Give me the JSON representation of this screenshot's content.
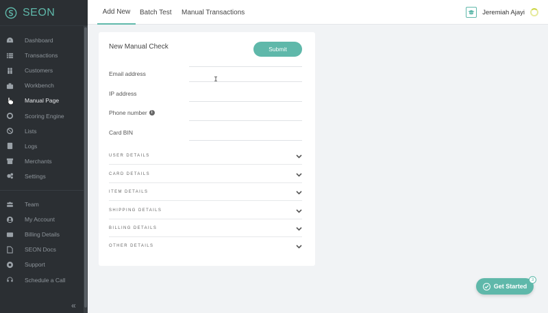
{
  "brand": {
    "name": "SEON"
  },
  "sidebar": {
    "items": [
      {
        "label": "Dashboard",
        "icon": "dashboard-icon"
      },
      {
        "label": "Transactions",
        "icon": "list-icon"
      },
      {
        "label": "Customers",
        "icon": "customers-icon"
      },
      {
        "label": "Workbench",
        "icon": "briefcase-icon"
      },
      {
        "label": "Manual Page",
        "icon": "pointer-icon"
      },
      {
        "label": "Scoring Engine",
        "icon": "engine-icon"
      },
      {
        "label": "Lists",
        "icon": "ban-icon"
      },
      {
        "label": "Logs",
        "icon": "logs-icon"
      },
      {
        "label": "Merchants",
        "icon": "store-icon"
      },
      {
        "label": "Settings",
        "icon": "gear-icon"
      }
    ],
    "items2": [
      {
        "label": "Team",
        "icon": "team-icon"
      },
      {
        "label": "My Account",
        "icon": "account-icon"
      },
      {
        "label": "Billing Details",
        "icon": "billing-icon"
      },
      {
        "label": "SEON Docs",
        "icon": "docs-icon"
      },
      {
        "label": "Support",
        "icon": "support-icon"
      },
      {
        "label": "Schedule a Call",
        "icon": "headset-icon"
      }
    ],
    "collapse_label": "«",
    "active_index": 4
  },
  "topbar": {
    "tabs": [
      "Add New",
      "Batch Test",
      "Manual Transactions"
    ],
    "active_tab": 0,
    "user_name": "Jeremiah Ajayi"
  },
  "card": {
    "title": "New Manual Check",
    "submit_label": "Submit",
    "fields": [
      {
        "label": "Email address",
        "value": ""
      },
      {
        "label": "IP address",
        "value": ""
      },
      {
        "label": "Phone number",
        "value": "",
        "info": true
      },
      {
        "label": "Card BIN",
        "value": ""
      }
    ],
    "sections": [
      "USER DETAILS",
      "CARD DETAILS",
      "ITEM DETAILS",
      "SHIPPING DETAILS",
      "BILLING DETAILS",
      "OTHER DETAILS"
    ]
  },
  "get_started": {
    "label": "Get Started",
    "count": "3"
  },
  "colors": {
    "accent": "#5fb8aa",
    "sidebar_bg": "#2b2f33",
    "page_bg": "#f1f3f5"
  }
}
